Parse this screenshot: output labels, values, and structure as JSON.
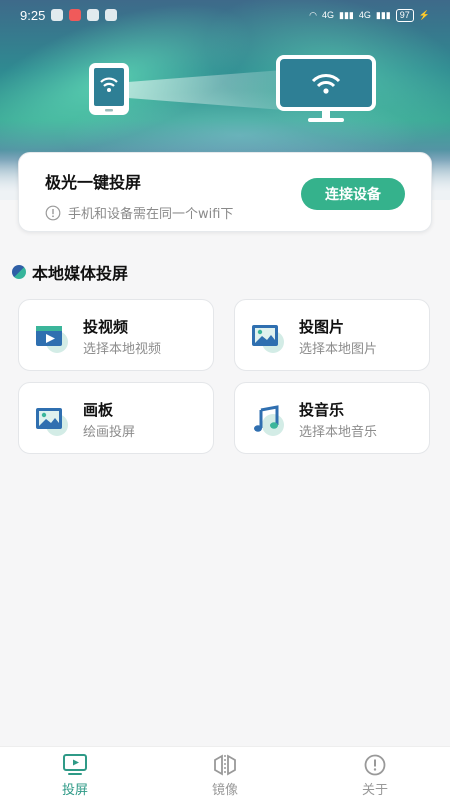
{
  "status_bar": {
    "time": "9:25",
    "network_1": "4G",
    "network_2": "4G",
    "battery": "97"
  },
  "hero": {
    "card_title": "极光一键投屏",
    "hint": "手机和设备需在同一个wifi下",
    "connect_button": "连接设备"
  },
  "section": {
    "title": "本地媒体投屏"
  },
  "tiles": [
    {
      "title": "投视频",
      "subtitle": "选择本地视频",
      "icon": "video-icon"
    },
    {
      "title": "投图片",
      "subtitle": "选择本地图片",
      "icon": "image-icon"
    },
    {
      "title": "画板",
      "subtitle": "绘画投屏",
      "icon": "drawing-board-icon"
    },
    {
      "title": "投音乐",
      "subtitle": "选择本地音乐",
      "icon": "music-icon"
    }
  ],
  "tabbar": {
    "items": [
      {
        "label": "投屏",
        "icon": "cast-icon",
        "active": true
      },
      {
        "label": "镜像",
        "icon": "mirror-icon",
        "active": false
      },
      {
        "label": "关于",
        "icon": "about-icon",
        "active": false
      }
    ]
  },
  "colors": {
    "accent": "#35b28c",
    "active_tab": "#2f9a87",
    "icon_blue": "#2f6fb0",
    "icon_green": "#3bb59a"
  }
}
